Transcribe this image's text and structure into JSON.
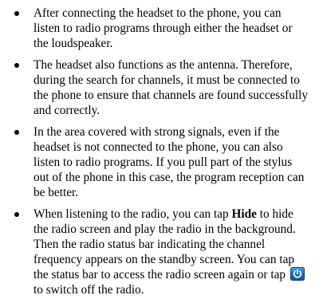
{
  "items": [
    {
      "text": "After connecting the headset to the phone, you can listen to radio programs through either the headset or the loudspeaker."
    },
    {
      "text": "The headset also functions as the antenna. Therefore, during the search for channels, it must be connected to the phone to ensure that channels are found successfully and correctly."
    },
    {
      "text": "In the area covered with strong signals, even if the headset is not connected to the phone, you can also listen to radio programs. If you pull part of the stylus out of the phone in this case, the program reception can be better."
    },
    {
      "text_before": "When listening to the radio, you can tap ",
      "bold": "Hide",
      "text_middle": " to hide the radio screen and play the radio in the background. Then the radio status bar indicating the channel frequency appears on the standby screen. You can tap the status bar to access the radio screen again or tap",
      "icon": "power-off-icon",
      "text_after": "to switch off the radio."
    }
  ],
  "colors": {
    "text": "#000000",
    "icon_blue": "#1f6fb8"
  }
}
